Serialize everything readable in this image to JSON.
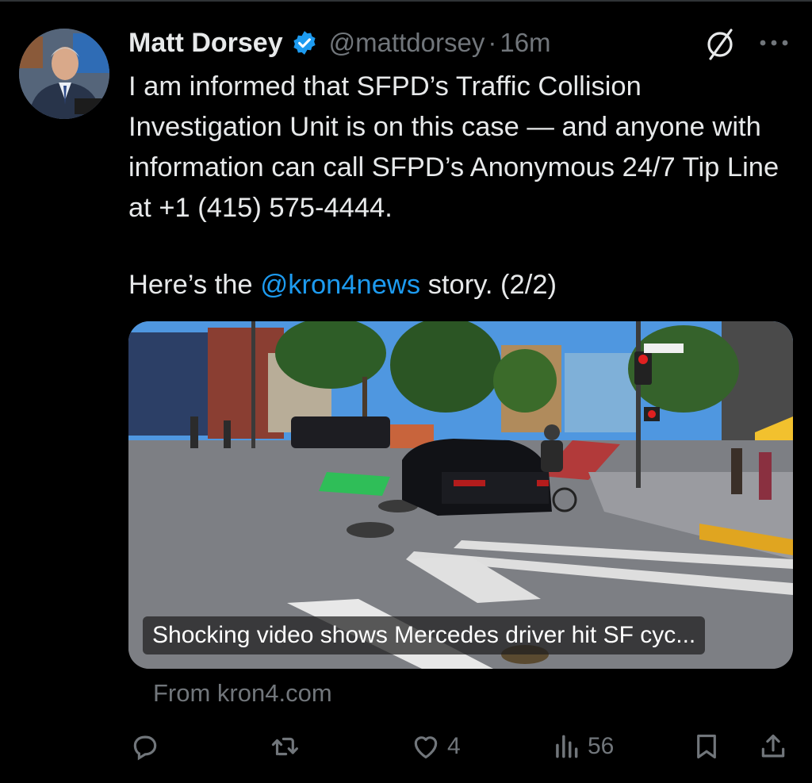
{
  "tweet": {
    "author_name": "Matt Dorsey",
    "handle": "@mattdorsey",
    "separator": "·",
    "time": "16m",
    "verified": true,
    "text": "I am informed that SFPD’s Traffic Collision Investigation Unit is on this case — and anyone with information can call SFPD’s Anonymous 24/7 Tip Line at +1 (415) 575-4444.",
    "story_prefix": "Here’s the",
    "story_mention": "@kron4news",
    "story_suffix": "story. (2/2)"
  },
  "link_card": {
    "title": "Shocking video shows Mercedes driver hit SF cyc...",
    "source": "From kron4.com"
  },
  "actions": {
    "reply_count": "",
    "repost_count": "",
    "like_count": "4",
    "views_count": "56"
  },
  "colors": {
    "background": "#000000",
    "text": "#e7e9ea",
    "secondary": "#71767b",
    "accent": "#1d9bf0"
  },
  "icons": [
    "verified-badge-icon",
    "grok-icon",
    "more-icon",
    "reply-icon",
    "repost-icon",
    "like-icon",
    "views-icon",
    "bookmark-icon",
    "share-icon"
  ]
}
